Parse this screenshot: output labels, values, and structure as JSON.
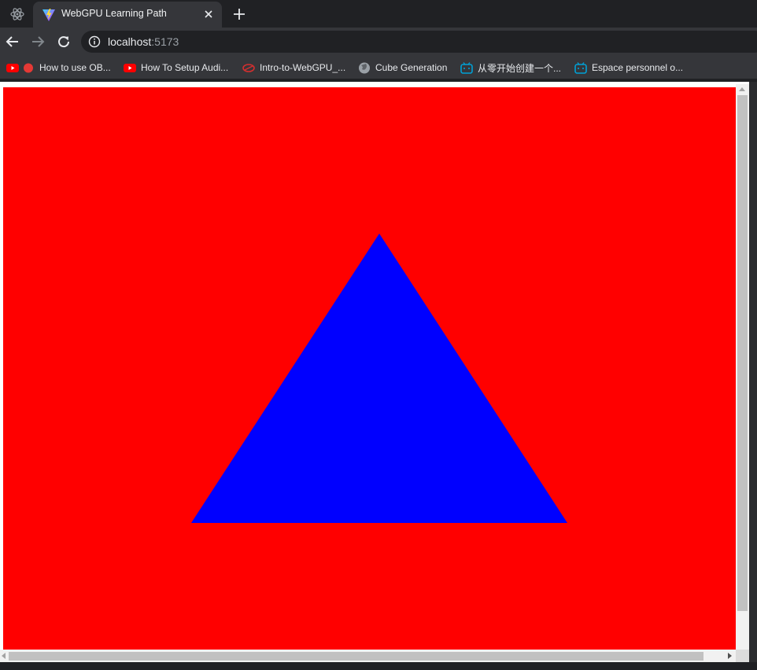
{
  "tab": {
    "title": "WebGPU Learning Path",
    "favicon": "vite-logo-icon"
  },
  "address": {
    "host": "localhost",
    "port": ":5173"
  },
  "bookmarks": [
    {
      "label": "How to use OB...",
      "icon": "youtube-icon"
    },
    {
      "label": "How To Setup Audi...",
      "icon": "youtube-icon"
    },
    {
      "label": "Intro-to-WebGPU_...",
      "icon": "webgpu-icon"
    },
    {
      "label": "Cube Generation",
      "icon": "globe-icon"
    },
    {
      "label": "从零开始创建一个...",
      "icon": "bilibili-icon"
    },
    {
      "label": "Espace personnel o...",
      "icon": "bilibili-icon"
    }
  ],
  "canvas": {
    "clear_color": "#ff0000",
    "triangle_color": "#0000ff"
  },
  "colors": {
    "tabstrip": "#202124",
    "toolbar": "#35363a",
    "youtube": "#ff0000",
    "bilibili": "#00a1d6"
  }
}
